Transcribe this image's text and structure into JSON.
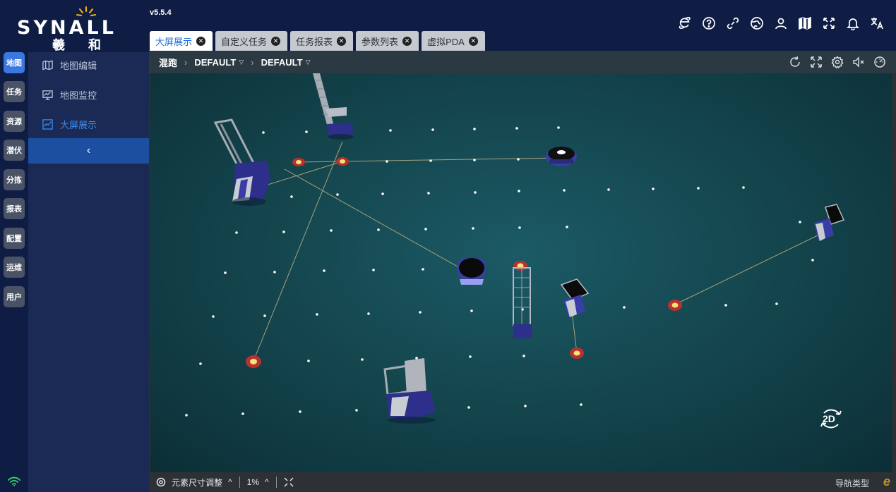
{
  "app": {
    "brand": "SYNALL",
    "brand_cn": "羲 和",
    "version": "v5.5.4"
  },
  "colors": {
    "navy": "#0f1d45",
    "accent": "#3a78e0",
    "scene": "#15474f",
    "marker_ring": "#b8312f",
    "marker_core": "#f2e37a"
  },
  "top_icons": [
    "ie-browser-icon",
    "help-icon",
    "link-icon",
    "globe-icon",
    "user-icon",
    "map-icon",
    "fullscreen-icon",
    "bell-icon",
    "translate-icon"
  ],
  "tabs": [
    {
      "label": "大屏展示",
      "active": true
    },
    {
      "label": "自定义任务",
      "active": false
    },
    {
      "label": "任务报表",
      "active": false
    },
    {
      "label": "参数列表",
      "active": false
    },
    {
      "label": "虚拟PDA",
      "active": false
    }
  ],
  "rail": [
    {
      "label": "地图",
      "active": true
    },
    {
      "label": "任务",
      "active": false
    },
    {
      "label": "资源",
      "active": false
    },
    {
      "label": "潜伏",
      "active": false
    },
    {
      "label": "分拣",
      "active": false
    },
    {
      "label": "报表",
      "active": false
    },
    {
      "label": "配置",
      "active": false
    },
    {
      "label": "运维",
      "active": false
    },
    {
      "label": "用户",
      "active": false
    }
  ],
  "submenu": [
    {
      "label": "地图编辑",
      "icon": "map-edit-icon",
      "active": false
    },
    {
      "label": "地图监控",
      "icon": "monitor-icon",
      "active": false
    },
    {
      "label": "大屏展示",
      "icon": "chart-line-icon",
      "active": true
    }
  ],
  "breadcrumb": {
    "root": "混跑",
    "level1": "DEFAULT",
    "level2": "DEFAULT"
  },
  "view_tools": [
    "refresh-icon",
    "fit-screen-icon",
    "settings-icon",
    "mute-icon",
    "gauge-icon"
  ],
  "scene": {
    "view_mode_button": "2D"
  },
  "bottom": {
    "size_adjust_label": "元素尺寸调整",
    "zoom": "1%",
    "nav_type_label": "导航类型"
  },
  "watermark": "e"
}
